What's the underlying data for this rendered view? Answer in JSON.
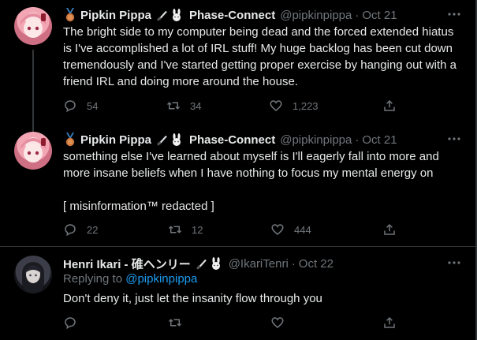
{
  "tweets": [
    {
      "author": "Pipkin Pippa",
      "affiliation": "Phase-Connect",
      "handle": "@pipkinpippa",
      "date": "Oct 21",
      "text": "The bright side to my computer being dead and the forced extended hiatus is I've accomplished a lot of IRL stuff! My huge backlog has been cut down tremendously and I've started getting proper exercise by hanging out with a friend IRL and doing more around the house.",
      "replies": "54",
      "retweets": "34",
      "likes": "1,223"
    },
    {
      "author": "Pipkin Pippa",
      "affiliation": "Phase-Connect",
      "handle": "@pipkinpippa",
      "date": "Oct 21",
      "text": "something else I've learned about myself is I'll eagerly fall into more and more insane beliefs when I have nothing to focus my mental energy on\n\n[ misinformation™ redacted ]",
      "replies": "22",
      "retweets": "12",
      "likes": "444"
    },
    {
      "author": "Henri Ikari - 碓ヘンリー",
      "handle": "@IkariTenri",
      "date": "Oct 22",
      "replying_prefix": "Replying to ",
      "replying_to": "@pipkinpippa",
      "text": "Don't deny it, just let the insanity flow through you"
    }
  ],
  "separator": "·",
  "colors": {
    "background": "#000000",
    "text": "#e7e9ea",
    "muted": "#71767b",
    "link": "#1d9bf0"
  },
  "icons": [
    "bronze-medal-icon",
    "knife-icon",
    "bunny-icon",
    "more-icon",
    "reply-icon",
    "retweet-icon",
    "like-icon",
    "share-icon"
  ]
}
